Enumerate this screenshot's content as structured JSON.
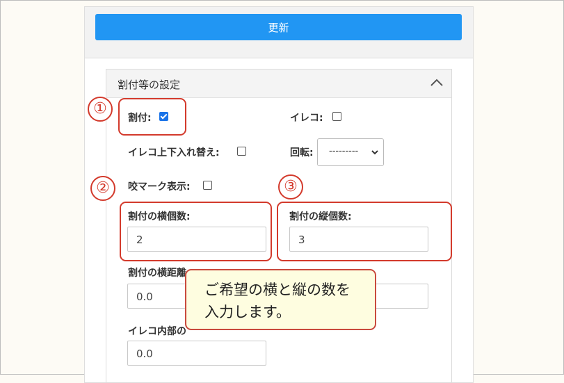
{
  "toolbar": {
    "update_label": "更新"
  },
  "section": {
    "title": "割付等の設定"
  },
  "fields": {
    "imposition_label": "割付:",
    "imposition_checked": true,
    "ireko_label": "イレコ:",
    "ireko_checked": false,
    "ireko_swap_label": "イレコ上下入れ替え:",
    "ireko_swap_checked": false,
    "rotation_label": "回転:",
    "rotation_value": "---------",
    "bite_mark_label": "咬マーク表示:",
    "bite_mark_checked": false,
    "horiz_count_label": "割付の横個数:",
    "horiz_count_value": "2",
    "vert_count_label": "割付の縦個数:",
    "vert_count_value": "3",
    "horiz_distance_label": "割付の横距離",
    "horiz_distance_value": "0.0",
    "vert_distance_value": "",
    "ireko_inner_label": "イレコ内部の",
    "ireko_inner_value": "0.0"
  },
  "annotations": {
    "num1": "①",
    "num2": "②",
    "num3": "③",
    "callout": "ご希望の横と縦の数を\n入力します。"
  },
  "colors": {
    "accent": "#2196f3",
    "annotation": "#d33a2c",
    "callout_bg": "#fefde0"
  },
  "icons": {
    "collapse": "chevron-up-icon",
    "select": "chevron-down-icon"
  }
}
